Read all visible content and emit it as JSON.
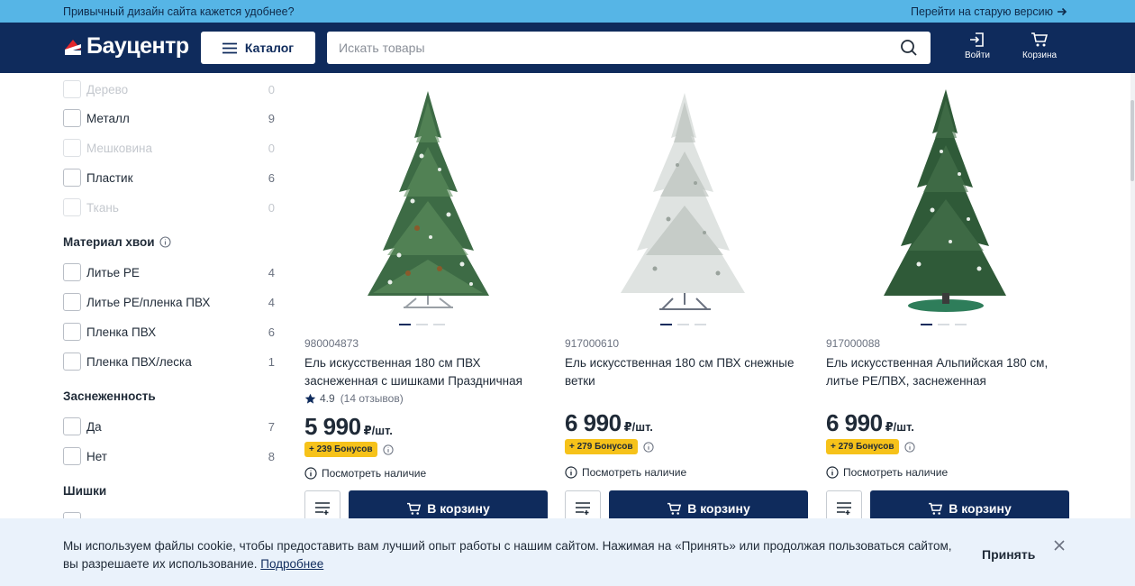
{
  "topbar": {
    "message": "Привычный дизайн сайта кажется удобнее?",
    "old_version_link": "Перейти на старую версию"
  },
  "header": {
    "logo_text": "Бауцентр",
    "catalog_label": "Каталог",
    "search_placeholder": "Искать товары",
    "login_label": "Войти",
    "cart_label": "Корзина"
  },
  "filters": {
    "material_options": [
      {
        "label": "Дерево",
        "count": "0",
        "disabled": true
      },
      {
        "label": "Металл",
        "count": "9",
        "disabled": false
      },
      {
        "label": "Мешковина",
        "count": "0",
        "disabled": true
      },
      {
        "label": "Пластик",
        "count": "6",
        "disabled": false
      },
      {
        "label": "Ткань",
        "count": "0",
        "disabled": true
      }
    ],
    "needle_material_title": "Материал хвои",
    "needle_material_options": [
      {
        "label": "Литье РЕ",
        "count": "4"
      },
      {
        "label": "Литье РЕ/пленка ПВХ",
        "count": "4"
      },
      {
        "label": "Пленка ПВХ",
        "count": "6"
      },
      {
        "label": "Пленка ПВХ/леска",
        "count": "1"
      }
    ],
    "snow_title": "Заснеженность",
    "snow_options": [
      {
        "label": "Да",
        "count": "7"
      },
      {
        "label": "Нет",
        "count": "8"
      }
    ],
    "cones_title": "Шишки"
  },
  "products": [
    {
      "sku": "980004873",
      "name": "Ель искусственная 180 см ПВХ заснеженная с шишками Праздничная",
      "rating": "4.9",
      "reviews": "(14 отзывов)",
      "price": "5 990",
      "unit": "₽/шт.",
      "bonus": "+ 239 Бонусов",
      "availability": "Посмотреть наличие",
      "cart_label": "В корзину"
    },
    {
      "sku": "917000610",
      "name": "Ель искусственная 180 см ПВХ снежные ветки",
      "price": "6 990",
      "unit": "₽/шт.",
      "bonus": "+ 279 Бонусов",
      "availability": "Посмотреть наличие",
      "cart_label": "В корзину"
    },
    {
      "sku": "917000088",
      "name": "Ель искусственная Альпийская 180 см, литье РЕ/ПВХ, заснеженная",
      "price": "6 990",
      "unit": "₽/шт.",
      "bonus": "+ 279 Бонусов",
      "availability": "Посмотреть наличие",
      "cart_label": "В корзину"
    }
  ],
  "cookie": {
    "text": "Мы используем файлы cookie, чтобы предоставить вам лучший опыт работы с нашим сайтом. Нажимая на «Принять» или продолжая пользоваться сайтом, вы разрешаете их использование.",
    "more_link": "Подробнее",
    "accept_label": "Принять"
  },
  "colors": {
    "header_bg": "#0f2b5c",
    "topbar_bg": "#56b5e6",
    "bonus_badge": "#f6c21a",
    "cookie_bg": "#eaf2fb"
  }
}
